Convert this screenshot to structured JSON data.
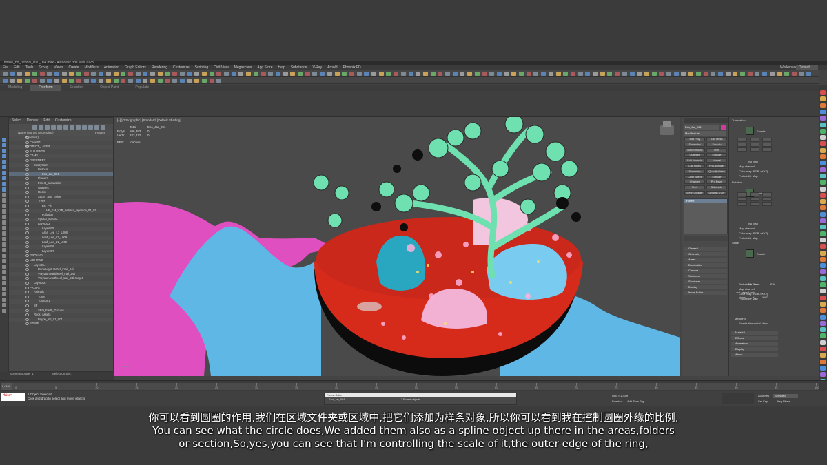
{
  "window": {
    "title": "finalle_bo_tutorial_v01_004.max - Autodesk 3ds Max 2023"
  },
  "menu": [
    "File",
    "Edit",
    "Tools",
    "Group",
    "Views",
    "Create",
    "Modifiers",
    "Animation",
    "Graph Editors",
    "Rendering",
    "Customize",
    "Scripting",
    "Civil View",
    "Megascans",
    "App Store",
    "Help",
    "Substance",
    "V-Ray",
    "Arnold",
    "Phoenix FD"
  ],
  "workspace": {
    "label": "Workspaces:",
    "value": "Default"
  },
  "ribbon_tabs": [
    "Modeling",
    "Freeform",
    "Selection",
    "Object Paint",
    "Populate"
  ],
  "scene_explorer": {
    "menu": [
      "Select",
      "Display",
      "Edit",
      "Customize"
    ],
    "header": "Name (Sorted Ascending)",
    "freeze_header": "Frozen",
    "rows": [
      "0 (default)",
      "Circle001",
      "PROJECT_LAYER",
      "BUILDINGS",
      "CAMS",
      "GREENERY",
      "Ecosystem",
      "Bushes",
      "Eco_Jar_001",
      "Flowers",
      "Forest_ansulation",
      "Grasses",
      "Rocks",
      "Sticks_and_Twigs",
      "Trees",
      "BR_Pth",
      "HP_FM_V7B_Serissa_japonica_01_03",
      "Foliation",
      "Splitter_Pebble",
      "Layer013",
      "Layer015",
      "Area_Lee_L1_L008",
      "Leaf_Lee_L1_L009",
      "Leaf_Lee_L1_L009",
      "Layer016",
      "Layer017",
      "GROUND",
      "LIGHTING",
      "Layer014",
      "DomeLightHitchel_Frail_24k",
      "VrayLum.varitheeel_trail_24k",
      "VrayLum.vartheeel_trail_24k.target",
      "Layer018",
      "PROPS",
      "Animals",
      "Turtle",
      "Turtle001",
      "SF",
      "SEO_Earth_Ground",
      "Rock_Assets",
      "Bayou_SF_01_001",
      "STUFF"
    ],
    "selected_index": 8,
    "footer_left": "Scene Explorer 1",
    "footer_right": "Selection Set:"
  },
  "viewport": {
    "label": "[+] [Orthographic] [Standard] [Default Shading]",
    "stats_header": [
      "Total",
      "Eco_Jar_001"
    ],
    "polys_label": "Polys:",
    "polys_total": "506,383",
    "polys_sel": "0",
    "verts_label": "Verts:",
    "verts_total": "323,472",
    "verts_sel": "0",
    "fps_label": "FPS:",
    "fps_value": "Inactive"
  },
  "command_panel": {
    "object_name": "Eco_Jar_001",
    "modifier_list": "Modifier List",
    "buttons": [
      "Edit Poly",
      "Edit Mesh",
      "Symmetry",
      "Smooth",
      "TurboSmooth",
      "Shell",
      "Optimize",
      "Extrude",
      "Edit Normals",
      "Normal",
      "Cap Holes",
      "ProOptimizer",
      "Symmetry",
      "Quadify Mesh",
      "Cloth Sheet",
      "Extrude",
      "Chamfer",
      "Pro Bevel",
      "Shell",
      "Subdivide",
      "Mesh Cleaner",
      "Unwrap UVW"
    ],
    "stack_item": "Forest",
    "rollouts": [
      "General",
      "Geometry",
      "Areas",
      "Distribution",
      "Camera",
      "Surfaces",
      "Shadows",
      "Display",
      "Items Editor"
    ]
  },
  "material_panel": {
    "sections": [
      "Translation",
      "Rotation",
      "Scale"
    ],
    "enable_label": "Enable",
    "map_labels": [
      "No Map",
      "Map channel",
      "Color map (RGB->XYZ)",
      "Probability Map",
      "Probability Curve",
      "Edit"
    ],
    "misc": [
      "Lock aspect ratio",
      "None",
      "X",
      "XYZ",
      "Mirroring",
      "Enable Horizontal Mirror"
    ],
    "rollouts": [
      "Material",
      "Effects",
      "Animation",
      "Display",
      "About"
    ]
  },
  "timeline": {
    "frame": "0 / 100",
    "ticks": [
      "0",
      "5",
      "10",
      "15",
      "20",
      "25",
      "30",
      "35",
      "40",
      "45",
      "50",
      "55",
      "60",
      "65",
      "70",
      "75",
      "80",
      "85",
      "90",
      "95",
      "100"
    ]
  },
  "status": {
    "maxscript": "\"false\"",
    "line1": "1 Object Selected",
    "line2": "Click and drag to select and move objects",
    "forest_color": "Forest Color",
    "forest_obj": "Eco_Jar_001",
    "forest_count": "2 Forest objects",
    "enabled": "Enabled:",
    "add_time_tag": "Add Time Tag",
    "auto_key": "Auto Key",
    "set_key": "Set Key",
    "selected": "Selected",
    "key_filters": "Key Filters...",
    "grid": "Grid = 10.0m"
  },
  "subtitles": {
    "zh": "你可以看到圆圈的作用,我们在区域文件夹或区域中,把它们添加为样条对象,所以你可以看到我在控制圆圈外缘的比例,",
    "en1": "You can see what the circle does,We added them also as a spline object up there in the areas,folders",
    "en2": "or section,So,yes,you can see that I'm controlling the scale of it,the outer edge of the ring,"
  },
  "colors": {
    "ground_blue": "#5fb7e6",
    "ground_pink": "#e04fbf",
    "bowl_red": "#d62a1a",
    "tree_green": "#6fe0b0"
  }
}
